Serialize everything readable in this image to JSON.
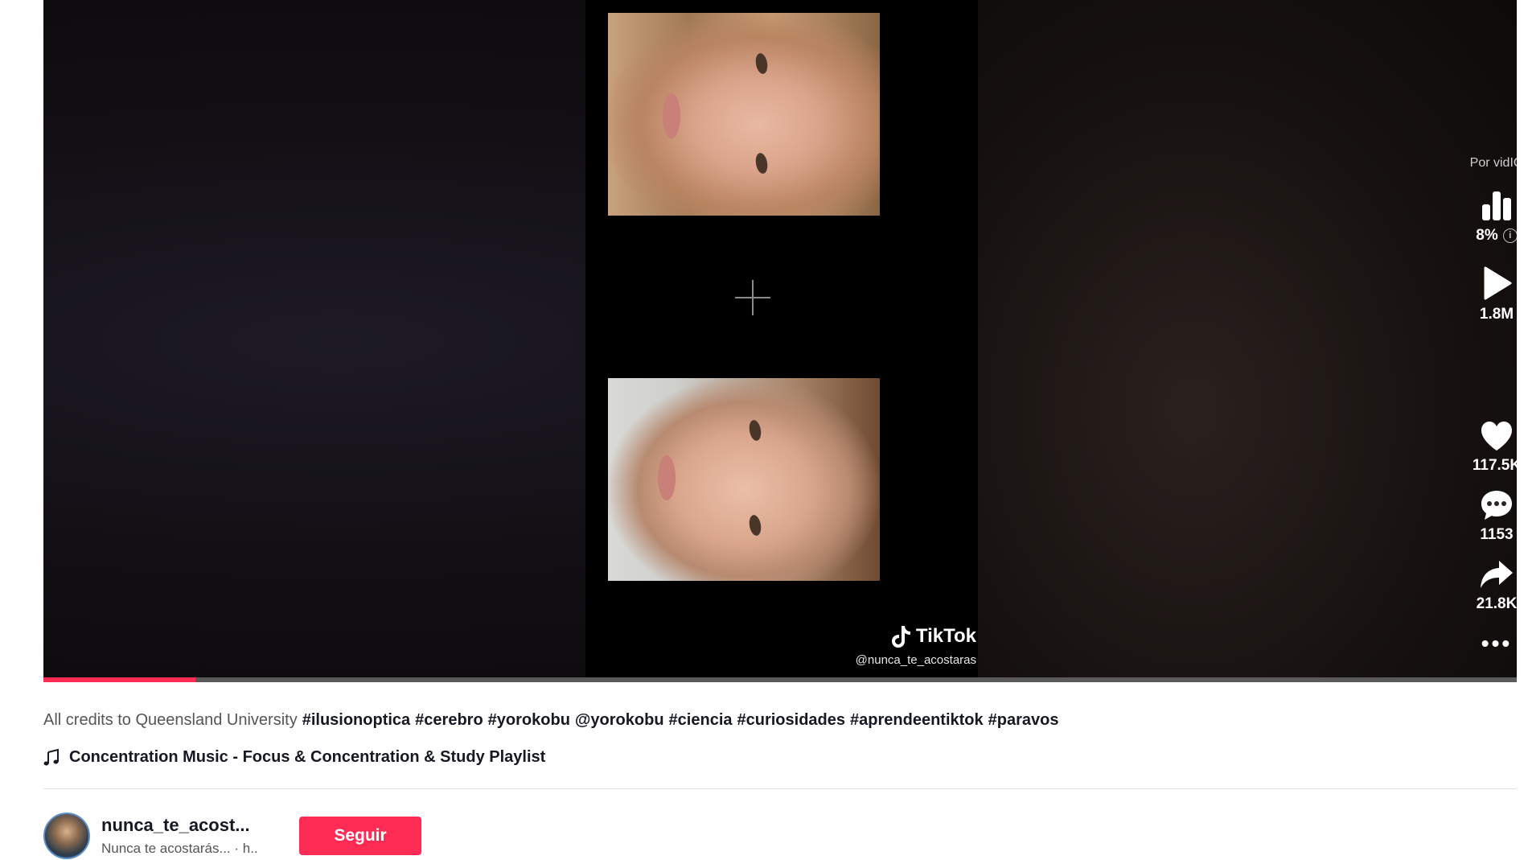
{
  "video": {
    "watermark_brand": "TikTok",
    "watermark_handle": "@nunca_te_acostaras",
    "progress_fraction": 0.103
  },
  "sidebar": {
    "vidiq_label": "Por vidIQ",
    "score": "8%",
    "views": "1.8M",
    "likes": "117.5K",
    "comments": "1153",
    "shares": "21.8K"
  },
  "caption": {
    "text": "All credits to Queensland University",
    "hashtags": [
      "#ilusionoptica",
      "#cerebro",
      "#yorokobu",
      "@yorokobu",
      "#ciencia",
      "#curiosidades",
      "#aprendeentiktok",
      "#paravos"
    ]
  },
  "music": {
    "title": "Concentration Music - Focus & Concentration & Study Playlist"
  },
  "author": {
    "username": "nunca_te_acost...",
    "subtitle": "Nunca te acostarás... · h..",
    "follow_label": "Seguir"
  },
  "colors": {
    "accent": "#fe2c55",
    "text": "#161823"
  }
}
